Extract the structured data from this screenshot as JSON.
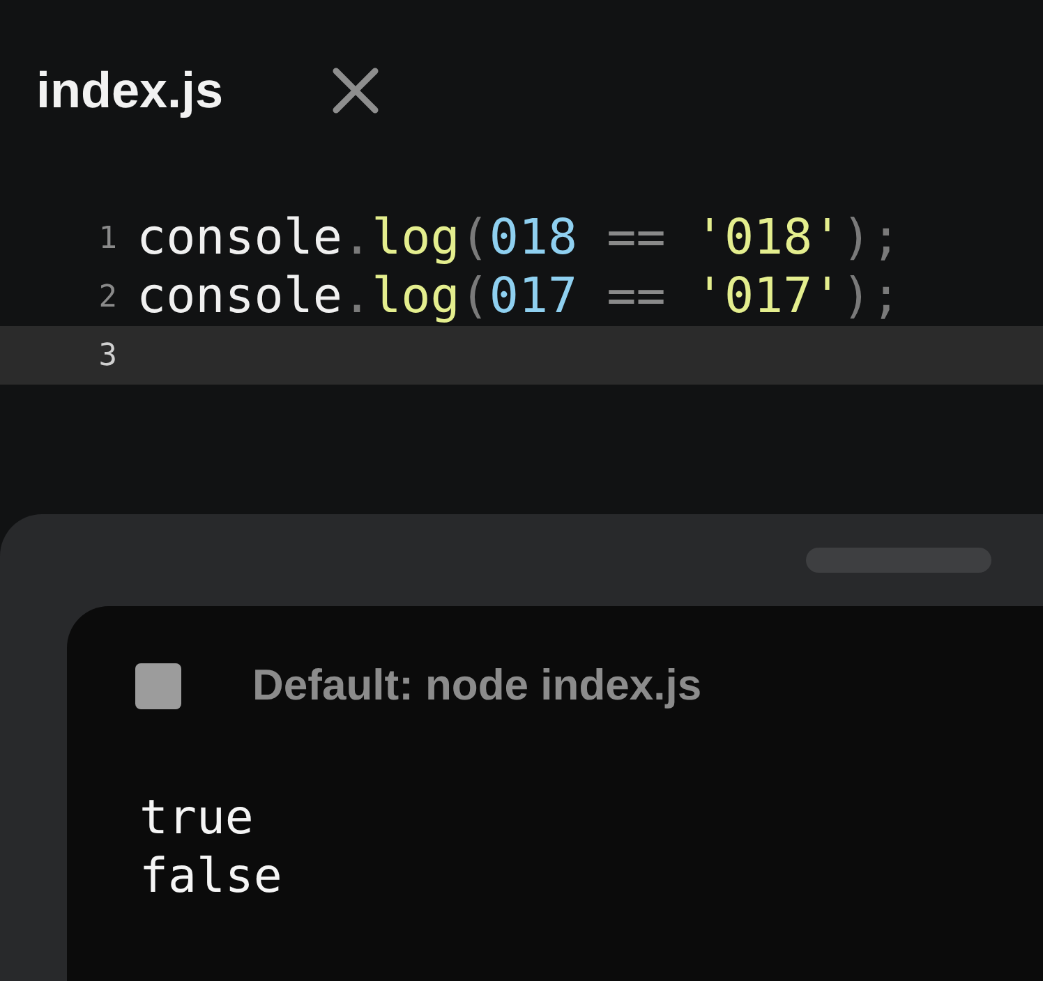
{
  "tab": {
    "title": "index.js"
  },
  "editor": {
    "lines": [
      {
        "number": "1",
        "current": false,
        "tokens": [
          {
            "kind": "plain",
            "text": "console"
          },
          {
            "kind": "punct",
            "text": "."
          },
          {
            "kind": "func",
            "text": "log"
          },
          {
            "kind": "punct",
            "text": "("
          },
          {
            "kind": "number",
            "text": "018"
          },
          {
            "kind": "op",
            "text": " == "
          },
          {
            "kind": "string",
            "text": "'018'"
          },
          {
            "kind": "punct",
            "text": ");"
          }
        ]
      },
      {
        "number": "2",
        "current": false,
        "tokens": [
          {
            "kind": "plain",
            "text": "console"
          },
          {
            "kind": "punct",
            "text": "."
          },
          {
            "kind": "func",
            "text": "log"
          },
          {
            "kind": "punct",
            "text": "("
          },
          {
            "kind": "number",
            "text": "017"
          },
          {
            "kind": "op",
            "text": " == "
          },
          {
            "kind": "string",
            "text": "'017'"
          },
          {
            "kind": "punct",
            "text": ");"
          }
        ]
      },
      {
        "number": "3",
        "current": true
      }
    ]
  },
  "console": {
    "title": "Default: node index.js",
    "output": [
      "true",
      "false"
    ]
  }
}
